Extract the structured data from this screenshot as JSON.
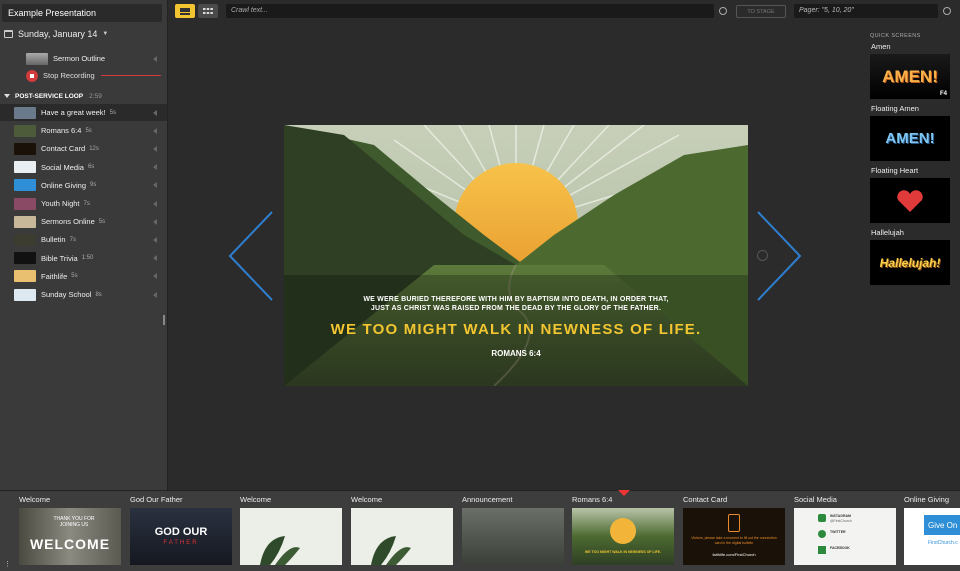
{
  "presentation": {
    "title": "Example Presentation",
    "date": "Sunday, January 14"
  },
  "sidebar": {
    "top_items": [
      {
        "label": "Sermon Outline"
      },
      {
        "label": "Stop Recording"
      }
    ],
    "loop": {
      "label": "POST-SERVICE LOOP",
      "duration": "2:59"
    },
    "loop_items": [
      {
        "label": "Have a great week!",
        "duration": "5s",
        "thumb": "#6a7a8a"
      },
      {
        "label": "Romans 6:4",
        "duration": "5s",
        "thumb": "#4d5b3a"
      },
      {
        "label": "Contact Card",
        "duration": "12s",
        "thumb": "#1a1208"
      },
      {
        "label": "Social Media",
        "duration": "6s",
        "thumb": "#e9eef2"
      },
      {
        "label": "Online Giving",
        "duration": "9s",
        "thumb": "#2f8fd6"
      },
      {
        "label": "Youth Night",
        "duration": "7s",
        "thumb": "#8a4a66"
      },
      {
        "label": "Sermons Online",
        "duration": "5s",
        "thumb": "#c8b89a"
      },
      {
        "label": "Bulletin",
        "duration": "7s",
        "thumb": "#3c3c30"
      },
      {
        "label": "Bible Trivia",
        "duration": "1:50",
        "thumb": "#111111"
      },
      {
        "label": "Faithlife",
        "duration": "5s",
        "thumb": "#e8c070"
      },
      {
        "label": "Sunday School",
        "duration": "8s",
        "thumb": "#dde8f0"
      }
    ]
  },
  "toolbar": {
    "crawl_placeholder": "Crawl text...",
    "stage_label": "TO STAGE",
    "pager_value": "Pager: \"5, 10, 20\""
  },
  "slide": {
    "line1": "WE WERE BURIED THEREFORE WITH HIM BY BAPTISM INTO DEATH, IN ORDER THAT,",
    "line2": "JUST AS CHRIST WAS RAISED FROM THE DEAD BY THE GLORY OF THE FATHER.",
    "emphasis": "WE TOO MIGHT WALK IN NEWNESS OF LIFE.",
    "reference": "ROMANS 6:4"
  },
  "quick_screens": {
    "heading": "QUICK SCREENS",
    "items": [
      {
        "label": "Amen",
        "thumb_text": "AMEN!",
        "key": "F4"
      },
      {
        "label": "Floating Amen",
        "thumb_text": "AMEN!"
      },
      {
        "label": "Floating Heart"
      },
      {
        "label": "Hallelujah",
        "thumb_text": "Hallelujah!"
      }
    ]
  },
  "filmstrip": [
    {
      "label": "Welcome",
      "thumb_text": "WELCOME",
      "thumb_small": "THANK YOU FOR JOINING US"
    },
    {
      "label": "God Our Father",
      "thumb_text": "GOD OUR",
      "thumb_small": "FATHER"
    },
    {
      "label": "Welcome"
    },
    {
      "label": "Welcome"
    },
    {
      "label": "Announcement"
    },
    {
      "label": "Romans 6:4",
      "thumb_text": "WE TOO MIGHT WALK IN NEWNESS OF LIFE."
    },
    {
      "label": "Contact Card",
      "thumb_text": "Visitors, please take a moment to fill out the connection card in the digital bulletin",
      "thumb_small": "faithlife.com/FirstChurch"
    },
    {
      "label": "Social Media",
      "thumb_text": "INSTAGRAM",
      "thumb_small": "@FirstChurch",
      "t2": "TWITTER",
      "t3": "FACEBOOK"
    },
    {
      "label": "Online Giving",
      "thumb_text": "Give On",
      "thumb_small": "FirstChurch.c"
    }
  ],
  "colors": {
    "accent": "#f2c531",
    "record": "#d23b3b",
    "nav_arrow": "#2f7fd0"
  }
}
